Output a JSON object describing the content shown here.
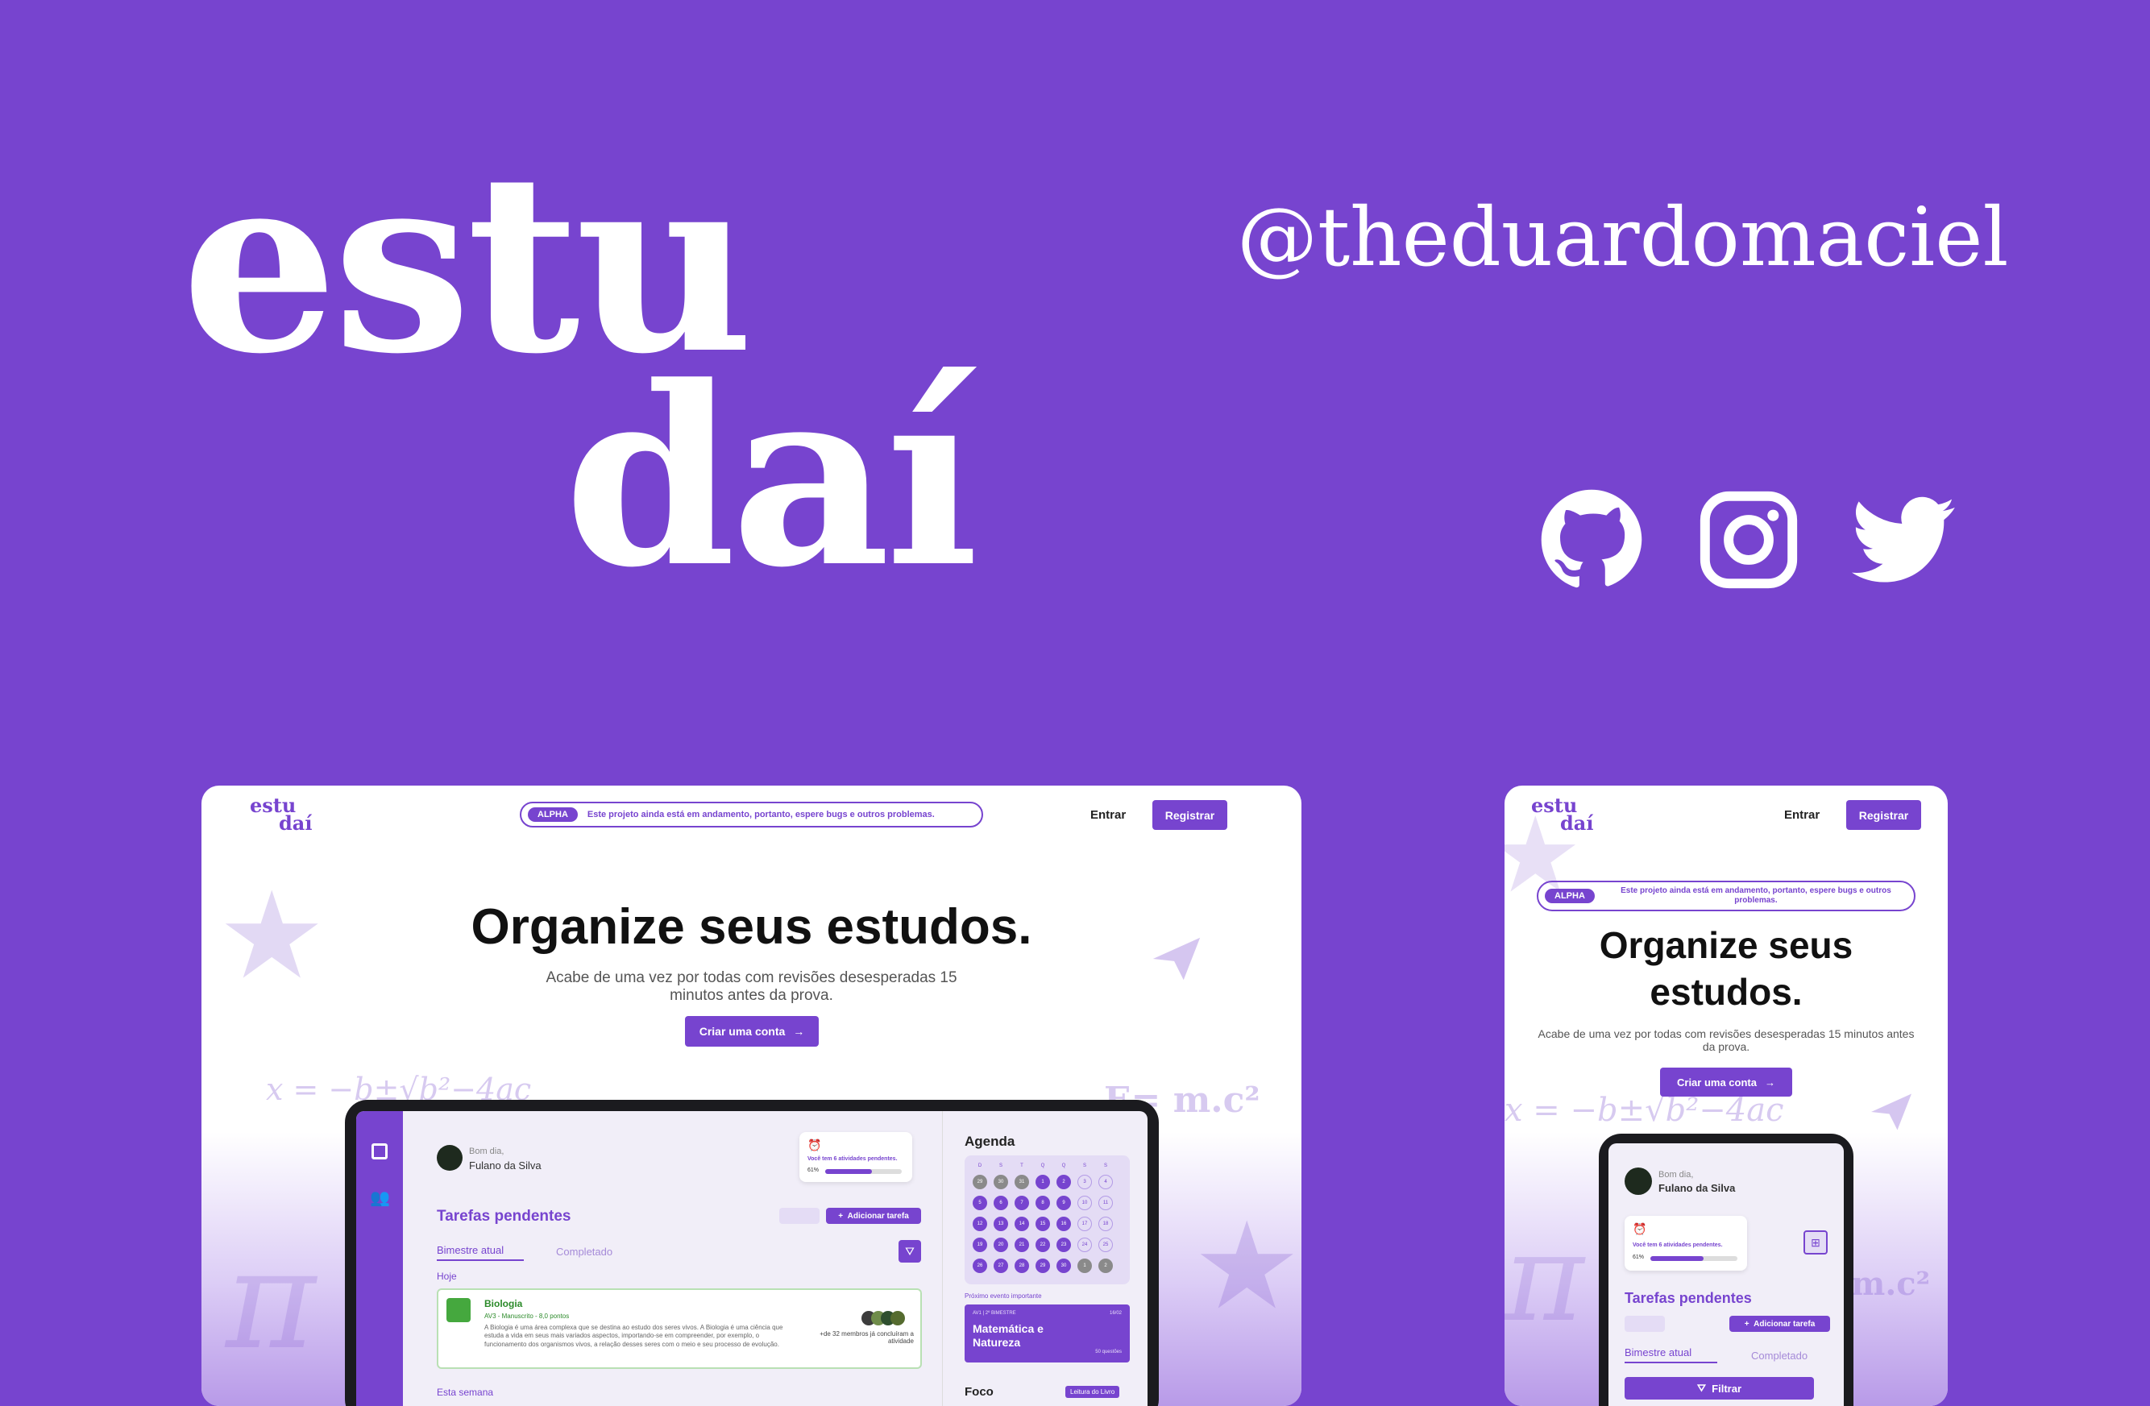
{
  "brand": {
    "line1": "estu",
    "line2": "daí",
    "handle": "@theduardomaciel"
  },
  "social": [
    {
      "name": "github-icon"
    },
    {
      "name": "instagram-icon"
    },
    {
      "name": "twitter-icon"
    }
  ],
  "colors": {
    "accent": "#7744cf",
    "background": "#7744cf",
    "text": "#111111"
  },
  "site": {
    "logo1": "estu",
    "logo2": "daí",
    "alpha_tag": "ALPHA",
    "alpha_text": "Este projeto ainda está em andamento, portanto, espere bugs e outros problemas.",
    "login": "Entrar",
    "register": "Registrar",
    "headline": "Organize seus estudos.",
    "subtitle": "Acabe de uma vez por todas com revisões desesperadas 15 minutos antes da prova.",
    "cta": "Criar uma conta",
    "deco_formula": "x = −b±√b²−4ac",
    "deco_emc": "E= m.c²",
    "deco_emc_mobile": "m.c²"
  },
  "app": {
    "greeting": "Bom dia,",
    "user": "Fulano da Silva",
    "pending_notice": "Você tem 6 atividades pendentes.",
    "progress_label": "61%",
    "progress_value": 0.61,
    "tasks_title": "Tarefas pendentes",
    "add_task": "Adicionar tarefa",
    "tab_current": "Bimestre atual",
    "tab_done": "Completado",
    "filter": "Filtrar",
    "today": "Hoje",
    "this_week": "Esta semana",
    "task": {
      "subject": "Biologia",
      "meta": "AV3 - Manuscrito - 8,0 pontos",
      "desc": "A Biologia é uma área complexa que se destina ao estudo dos seres vivos. A Biologia é uma ciência que estuda a vida em seus mais variados aspectos, importando-se em compreender, por exemplo, o funcionamento dos organismos vivos, a relação desses seres com o meio e seu processo de evolução.",
      "members": "+de 32 membros já concluíram a atividade"
    },
    "agenda_title": "Agenda",
    "weekdays": [
      "D",
      "S",
      "T",
      "Q",
      "Q",
      "S",
      "S"
    ],
    "calendar_days": [
      "29",
      "30",
      "31",
      "1",
      "2",
      "3",
      "4",
      "5",
      "6",
      "7",
      "8",
      "9",
      "10",
      "11",
      "12",
      "13",
      "14",
      "15",
      "16",
      "17",
      "18",
      "19",
      "20",
      "21",
      "22",
      "23",
      "24",
      "25",
      "26",
      "27",
      "28",
      "29",
      "30",
      "1",
      "2"
    ],
    "next_event_label": "Próximo evento importante",
    "event_meta": "AV1 | 2º BIMESTRE",
    "event_date": "16/02",
    "event_title": "Matemática e Natureza",
    "event_questions": "50 questões",
    "focus_title": "Foco",
    "focus_tag": "Leitura do Livro"
  }
}
